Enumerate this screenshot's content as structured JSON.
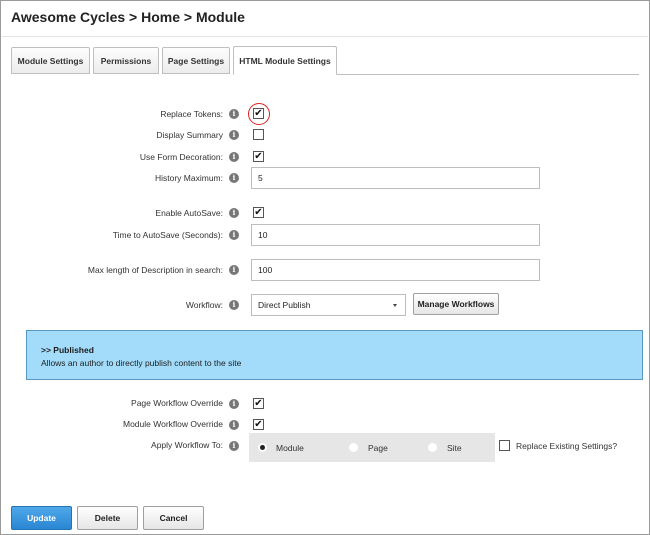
{
  "breadcrumb": "Awesome Cycles > Home > Module",
  "tabs": [
    {
      "label": "Module Settings"
    },
    {
      "label": "Permissions"
    },
    {
      "label": "Page Settings"
    },
    {
      "label": "HTML Module Settings",
      "active": true
    }
  ],
  "form": {
    "replace_tokens": {
      "label": "Replace Tokens:",
      "checked": true
    },
    "display_summary": {
      "label": "Display Summary",
      "checked": false
    },
    "use_form_decoration": {
      "label": "Use Form Decoration:",
      "checked": true
    },
    "history_maximum": {
      "label": "History Maximum:",
      "value": "5"
    },
    "enable_autosave": {
      "label": "Enable AutoSave:",
      "checked": true
    },
    "time_to_autosave": {
      "label": "Time to AutoSave (Seconds):",
      "value": "10"
    },
    "max_length_description": {
      "label": "Max length of Description in search:",
      "value": "100"
    },
    "workflow": {
      "label": "Workflow:",
      "selected": "Direct Publish",
      "manage_button": "Manage Workflows"
    },
    "page_workflow_override": {
      "label": "Page Workflow Override",
      "checked": true
    },
    "module_workflow_override": {
      "label": "Module Workflow Override",
      "checked": true
    },
    "apply_workflow_to": {
      "label": "Apply Workflow To:",
      "options": [
        "Module",
        "Page",
        "Site"
      ],
      "selected": "Module"
    },
    "replace_existing": {
      "label": "Replace Existing Settings?",
      "checked": false
    }
  },
  "workflow_notice": {
    "title": ">> Published",
    "description": "Allows an author to directly publish content to the site"
  },
  "actions": {
    "update": "Update",
    "delete": "Delete",
    "cancel": "Cancel"
  },
  "icons": {
    "info": "info-icon",
    "check": "checkmark-icon",
    "caret": "chevron-down-icon"
  },
  "colors": {
    "primary_button": "#2a86d3",
    "notice_bg": "#a2dcfa",
    "highlight_ring": "#dd2222"
  }
}
